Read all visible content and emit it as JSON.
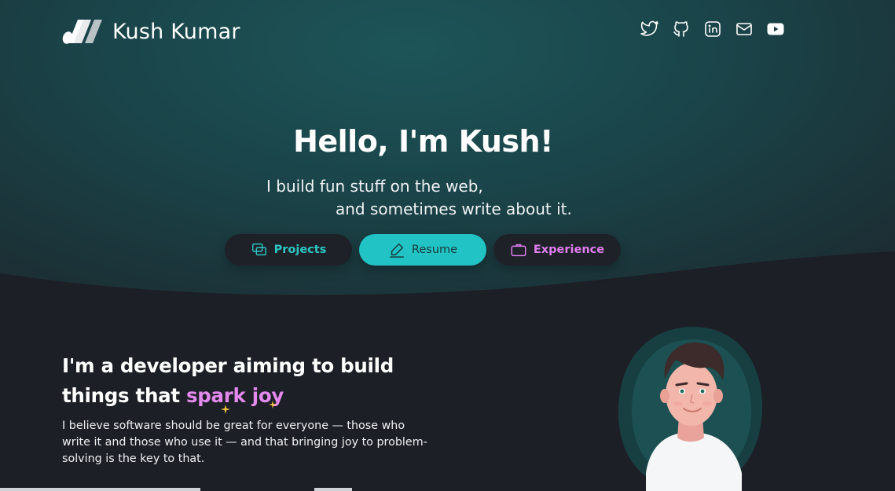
{
  "header": {
    "brand_name": "Kush Kumar",
    "socials": [
      {
        "icon": "twitter-icon"
      },
      {
        "icon": "github-icon"
      },
      {
        "icon": "linkedin-icon"
      },
      {
        "icon": "mail-icon"
      },
      {
        "icon": "youtube-icon"
      }
    ]
  },
  "hero": {
    "title": "Hello, I'm Kush!",
    "line1": "I build fun stuff on the web,",
    "line2": "and sometimes write about it.",
    "buttons": {
      "projects": "Projects",
      "resume": "Resume",
      "experience": "Experience"
    }
  },
  "about": {
    "heading_part1": "I'm a developer aiming to build",
    "heading_part2": "things that ",
    "heading_highlight": "spark joy",
    "body": "I believe software should be great for everyone — those who write it and those who use it — and that bringing joy to problem-solving is the key to that."
  },
  "colors": {
    "accent_teal": "#22c3c4",
    "accent_pink": "#e389ee",
    "background_dark": "#1c1f25",
    "hero_teal": "#1a4449"
  }
}
